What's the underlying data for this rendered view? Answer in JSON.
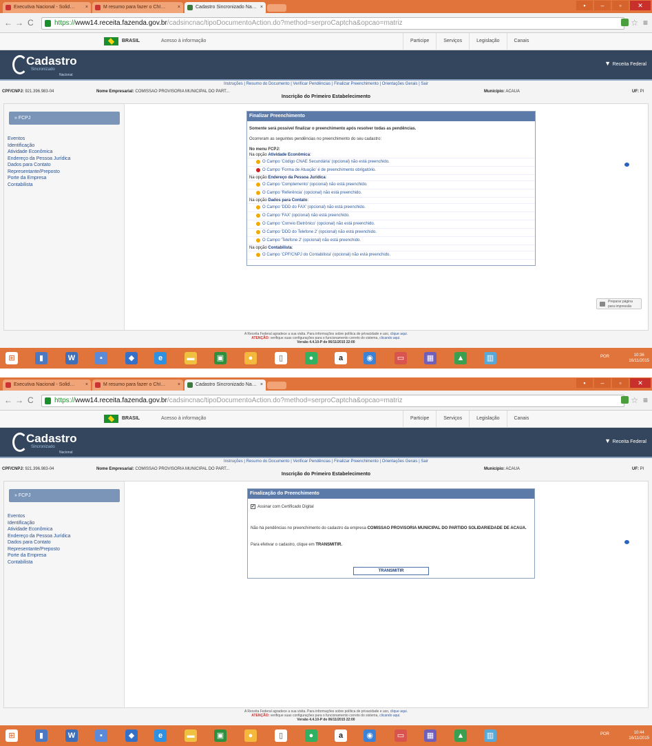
{
  "browser": {
    "tabs": [
      {
        "label": "Executiva Nacional - Solid…",
        "favicon_color": "#cc3333"
      },
      {
        "label": "M resumo para fazer o ChI…",
        "favicon_color": "#d44638"
      },
      {
        "label": "Cadastro Sincronizado Na…",
        "favicon_color": "#3a7a3a"
      }
    ],
    "url": {
      "host": "https://",
      "domain": "www14.receita.fazenda.gov.br",
      "path": "/cadsincnac/tipoDocumentoAction.do?method=serproCaptcha&opcao=matriz"
    }
  },
  "gov": {
    "brasil": "BRASIL",
    "acesso": "Acesso à informação",
    "links": [
      "Participe",
      "Serviços",
      "Legislação",
      "Canais"
    ]
  },
  "site": {
    "logo_main": "Cadastro",
    "logo_sub": "Sincronizado",
    "logo_tag": "Nacional",
    "rfb": "Receita Federal",
    "topnav": "Instruções | Resumo do Documento | Verificar Pendências | Finalizar Preenchimento | Orientações Gerais | Sair",
    "cnpj_label": "CPF/CNPJ:",
    "cnpj_value": "921.396.983-04",
    "nome_label": "Nome Empresarial:",
    "nome_value": "COMISSAO PROVISORIA MUNICIPAL DO PART...",
    "municipio_label": "Município:",
    "municipio_value": "ACAUA",
    "uf_label": "UF:",
    "uf_value": "PI",
    "inscricao": "Inscrição do Primeiro Estabelecimento"
  },
  "sidebar": {
    "head": "» FCPJ",
    "items": [
      "Eventos",
      "Identificação",
      "Atividade Econômica",
      "Endereço da Pessoa Jurídica",
      "Dados para Contato",
      "Representante/Preposto",
      "Porte da Empresa",
      "Contabilista"
    ]
  },
  "panel1": {
    "title": "Finalizar Preenchimento",
    "intro": "Somente será possível finalizar o preenchimento após resolver todas as pendências.",
    "sub": "Ocorreram as seguintes pendências no preenchimento do seu cadastro:",
    "menu": "No menu FCPJ:",
    "groups": [
      {
        "opcao": "Atividade Econômica",
        "items": [
          {
            "text": "O Campo 'Código CNAE Secundária' (opcional) não está preenchido.",
            "status": "warn"
          },
          {
            "text": "O Campo 'Forma de Atuação' é de preenchimento obrigatório.",
            "status": "error"
          }
        ]
      },
      {
        "opcao": "Endereço da Pessoa Jurídica",
        "items": [
          {
            "text": "O Campo 'Complemento' (opcional) não está preenchido.",
            "status": "warn"
          },
          {
            "text": "O Campo 'Referência' (opcional) não está preenchido.",
            "status": "warn"
          }
        ]
      },
      {
        "opcao": "Dados para Contato",
        "items": [
          {
            "text": "O Campo 'DDD do FAX' (opcional) não está preenchido.",
            "status": "warn"
          },
          {
            "text": "O Campo 'FAX' (opcional) não está preenchido.",
            "status": "warn"
          },
          {
            "text": "O Campo 'Correio Eletrônico' (opcional) não está preenchido.",
            "status": "warn"
          },
          {
            "text": "O Campo 'DDD do Telefone 2' (opcional) não está preenchido.",
            "status": "warn"
          },
          {
            "text": "O Campo 'Telefone 2' (opcional) não está preenchido.",
            "status": "warn"
          }
        ]
      },
      {
        "opcao": "Contabilista",
        "items": [
          {
            "text": "O Campo 'CPF/CNPJ do Contabilista' (opcional) não está preenchido.",
            "status": "warn"
          }
        ]
      }
    ],
    "opcao_prefix": "Na opção "
  },
  "print_btn": "Preparar página para impressão",
  "panel2": {
    "title": "Finalização do Preenchimento",
    "checkbox_label": "Assinar com Certificado Digital",
    "checkbox_mark": "✔",
    "text1_a": "Não há pendências no preenchimento do cadastro da empresa ",
    "text1_b": "COMISSAO PROVISORIA MUNICIPAL DO PARTIDO SOLIDARIEDADE DE ACAUA.",
    "text2_a": "Para efetivar o cadastro, clique em ",
    "text2_b": "TRANSMITIR.",
    "transmit": "TRANSMITIR"
  },
  "footer": {
    "line1a": "A Receita Federal agradece a sua visita. Para informações sobre política de privacidade e uso, ",
    "line1b": "clique aqui.",
    "line2a": "ATENÇÃO: ",
    "line2b": "verifique suas configurações para o funcionamento correto do sistema, ",
    "line2c": "clicando aqui.",
    "line3": "Versão 4.4.10-P de 06/11/2015 22:00"
  },
  "taskbar": {
    "tray": "POR",
    "time1": "10:36",
    "date1": "16/11/2015",
    "time2": "10:44",
    "date2": "16/11/2015"
  },
  "colors": {
    "accent": "#e0743a",
    "header": "#33465e",
    "panel_title": "#5c7aa8",
    "link": "#2f5aa0"
  }
}
